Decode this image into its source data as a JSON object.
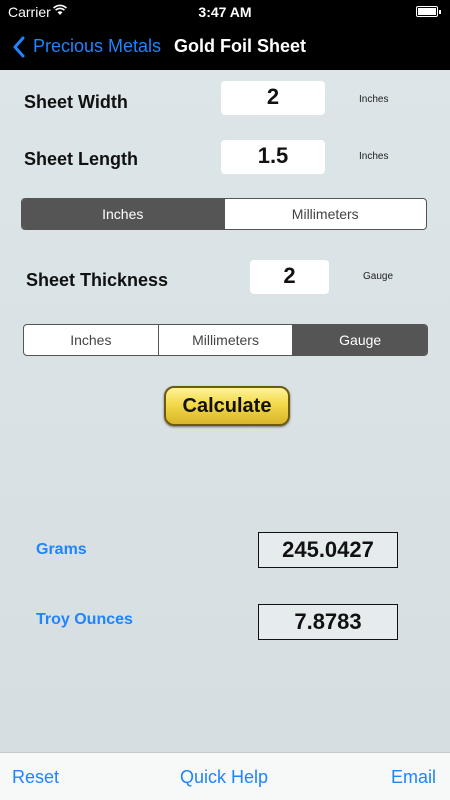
{
  "status_bar": {
    "carrier": "Carrier",
    "time": "3:47 AM"
  },
  "nav": {
    "back_label": "Precious Metals",
    "title": "Gold Foil Sheet"
  },
  "width_row": {
    "label": "Sheet Width",
    "value": "2",
    "unit": "Inches"
  },
  "length_row": {
    "label": "Sheet Length",
    "value": "1.5",
    "unit": "Inches"
  },
  "dimension_units": {
    "options": [
      "Inches",
      "Millimeters"
    ],
    "selected": "Inches"
  },
  "thickness_row": {
    "label": "Sheet Thickness",
    "value": "2",
    "unit": "Gauge"
  },
  "thickness_units": {
    "options": [
      "Inches",
      "Millimeters",
      "Gauge"
    ],
    "selected": "Gauge"
  },
  "calculate_label": "Calculate",
  "results": {
    "grams_label": "Grams",
    "grams_value": "245.0427",
    "troy_label": "Troy Ounces",
    "troy_value": "7.8783"
  },
  "toolbar": {
    "reset_label": "Reset",
    "help_label": "Quick Help",
    "email_label": "Email"
  },
  "colors": {
    "accent_blue": "#1e84ff",
    "segment_selected": "#555555",
    "button_gold": "#f3d94a"
  }
}
